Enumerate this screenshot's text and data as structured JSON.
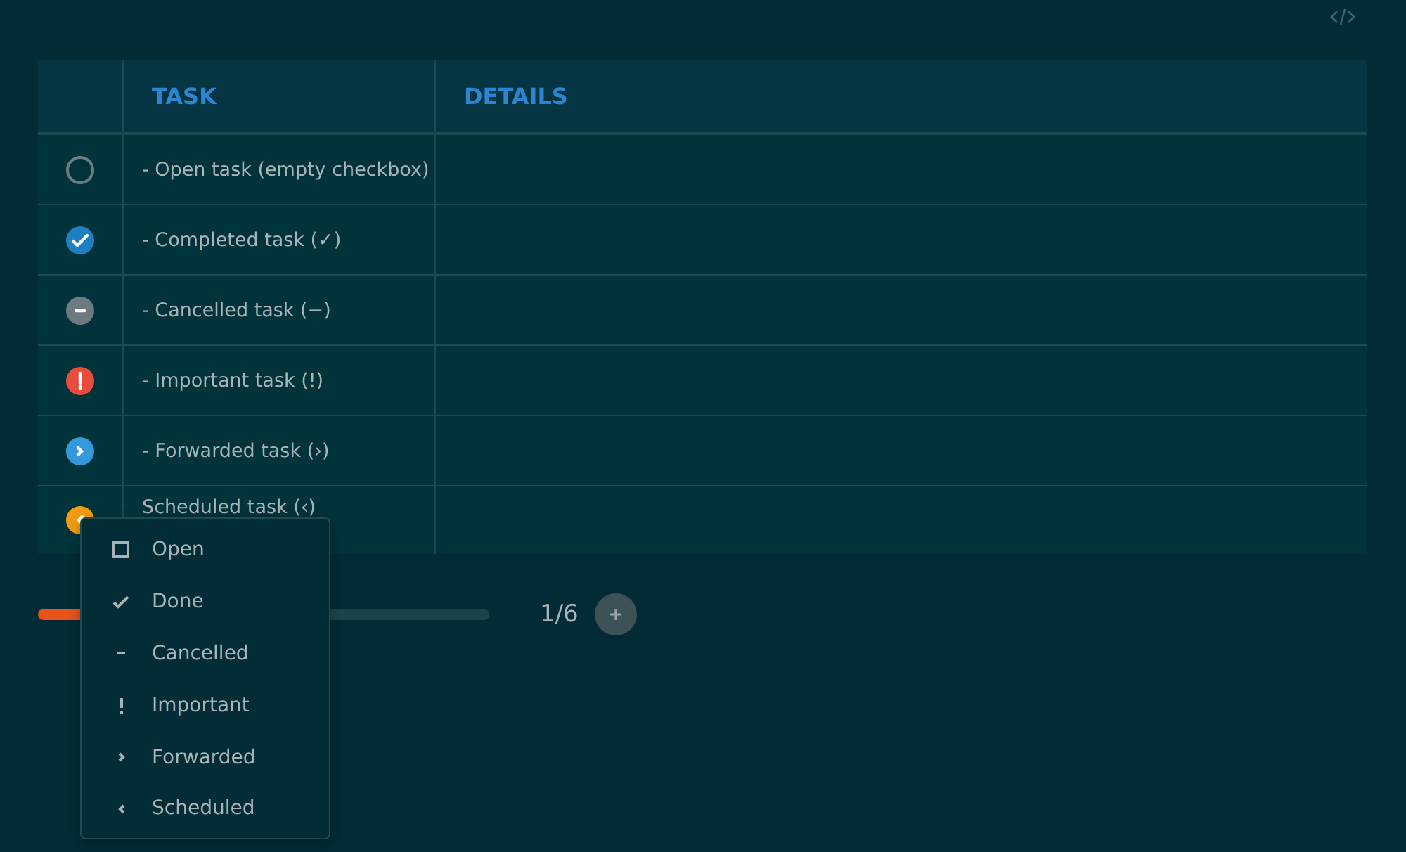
{
  "table": {
    "columns": [
      {
        "label": "TASK"
      },
      {
        "label": "DETAILS"
      }
    ],
    "rows": [
      {
        "status": {
          "kind": "open",
          "color": "#6b7b80"
        },
        "task": "- Open task (empty checkbox)"
      },
      {
        "status": {
          "kind": "done",
          "color": "#1f7fc4"
        },
        "task": "- Completed task (✓)"
      },
      {
        "status": {
          "kind": "cancelled",
          "color": "#6b7b80"
        },
        "task": "- Cancelled task (−)"
      },
      {
        "status": {
          "kind": "important",
          "color": "#e74c3c"
        },
        "task": "- Important task (!)"
      },
      {
        "status": {
          "kind": "forwarded",
          "color": "#3498db"
        },
        "task": "- Forwarded task (›)"
      },
      {
        "status": {
          "kind": "scheduled",
          "color": "#f39c12"
        },
        "task": "Scheduled task (‹)"
      }
    ]
  },
  "progress": {
    "level": 0.17,
    "reading": "1/6"
  },
  "status_menu": {
    "items": [
      {
        "kind": "open",
        "label": "Open"
      },
      {
        "kind": "done",
        "label": "Done"
      },
      {
        "kind": "cancelled",
        "label": "Cancelled"
      },
      {
        "kind": "important",
        "label": "Important"
      },
      {
        "kind": "forwarded",
        "label": "Forwarded"
      },
      {
        "kind": "scheduled",
        "label": "Scheduled"
      }
    ]
  }
}
